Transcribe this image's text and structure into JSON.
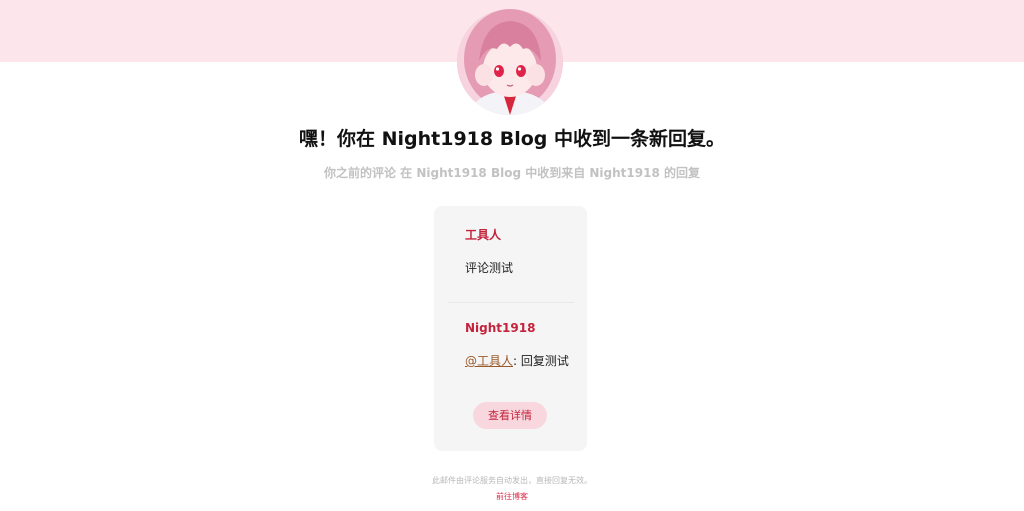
{
  "header": {
    "title": "嘿！你在 Night1918 Blog 中收到一条新回复。",
    "subtitle": "你之前的评论 在 Night1918 Blog 中收到来自 Night1918 的回复"
  },
  "card": {
    "original": {
      "author": "工具人",
      "text": "评论测试"
    },
    "reply": {
      "author": "Night1918",
      "mention": "@工具人",
      "separator": ": ",
      "text": "回复测试"
    },
    "button_label": "查看详情"
  },
  "footer": {
    "note": "此邮件由评论服务自动发出，直接回复无效。",
    "link_label": "前往博客"
  },
  "colors": {
    "banner": "#fce6ec",
    "accent": "#c4233c",
    "button_bg": "#f8d7df"
  }
}
